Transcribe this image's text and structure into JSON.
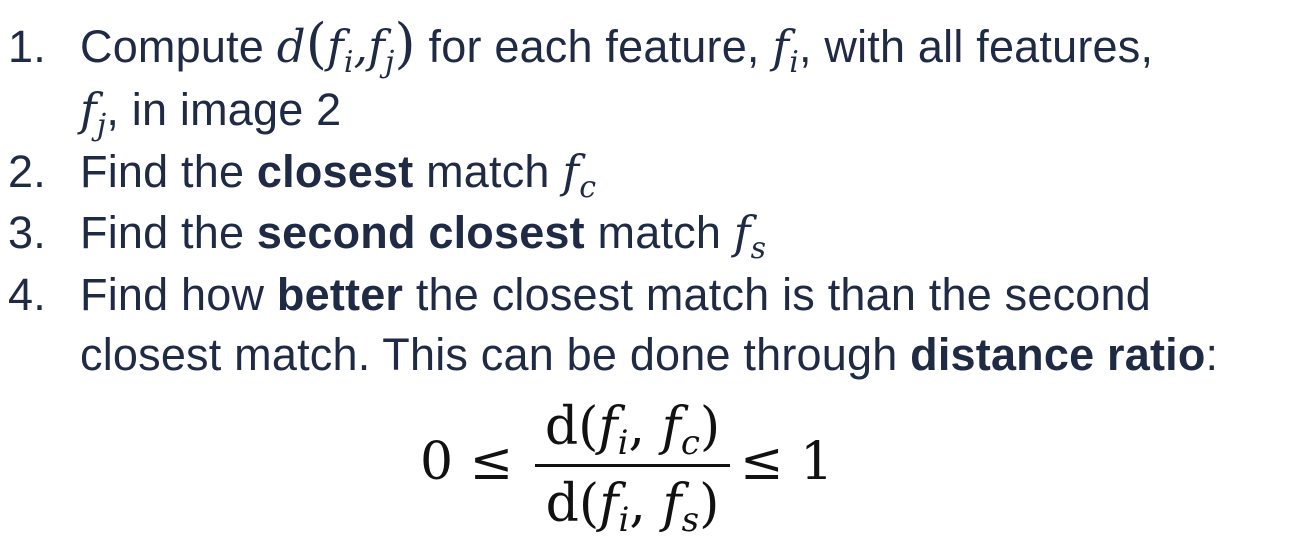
{
  "items": [
    {
      "number": "1.",
      "text_a": "Compute",
      "math_a": "d",
      "math_open": "(",
      "f1": "f",
      "s1": "i",
      "comma1": ",",
      "f2": "f",
      "s2": "j",
      "math_close": ")",
      "text_b": "for each feature,",
      "f3": "f",
      "s3": "i",
      "text_c": ", with all features,",
      "cont_f": "f",
      "cont_s": "j",
      "cont_text": ", in image 2"
    },
    {
      "number": "2.",
      "text_a": "Find the",
      "bold": "closest",
      "text_b": "match",
      "f": "f",
      "s": "c"
    },
    {
      "number": "3.",
      "text_a": "Find the",
      "bold": "second closest",
      "text_b": "match",
      "f": "f",
      "s": "s"
    },
    {
      "number": "4.",
      "text_a": "Find how",
      "bold": "better",
      "text_b": "the closest match is than the second",
      "cont_text": "closest match. This can be done through",
      "cont_bold": "distance ratio",
      "cont_end": ":"
    }
  ],
  "formula": {
    "lhs": "0 ≤",
    "numerator_d": "d(",
    "numerator_f1": "f",
    "numerator_s1": "i",
    "numerator_comma": ", ",
    "numerator_f2": "f",
    "numerator_s2": "c",
    "numerator_close": ")",
    "denominator_d": "d(",
    "denominator_f1": "f",
    "denominator_s1": "i",
    "denominator_comma": ", ",
    "denominator_f2": "f",
    "denominator_s2": "s",
    "denominator_close": ")",
    "rhs": "≤ 1"
  }
}
